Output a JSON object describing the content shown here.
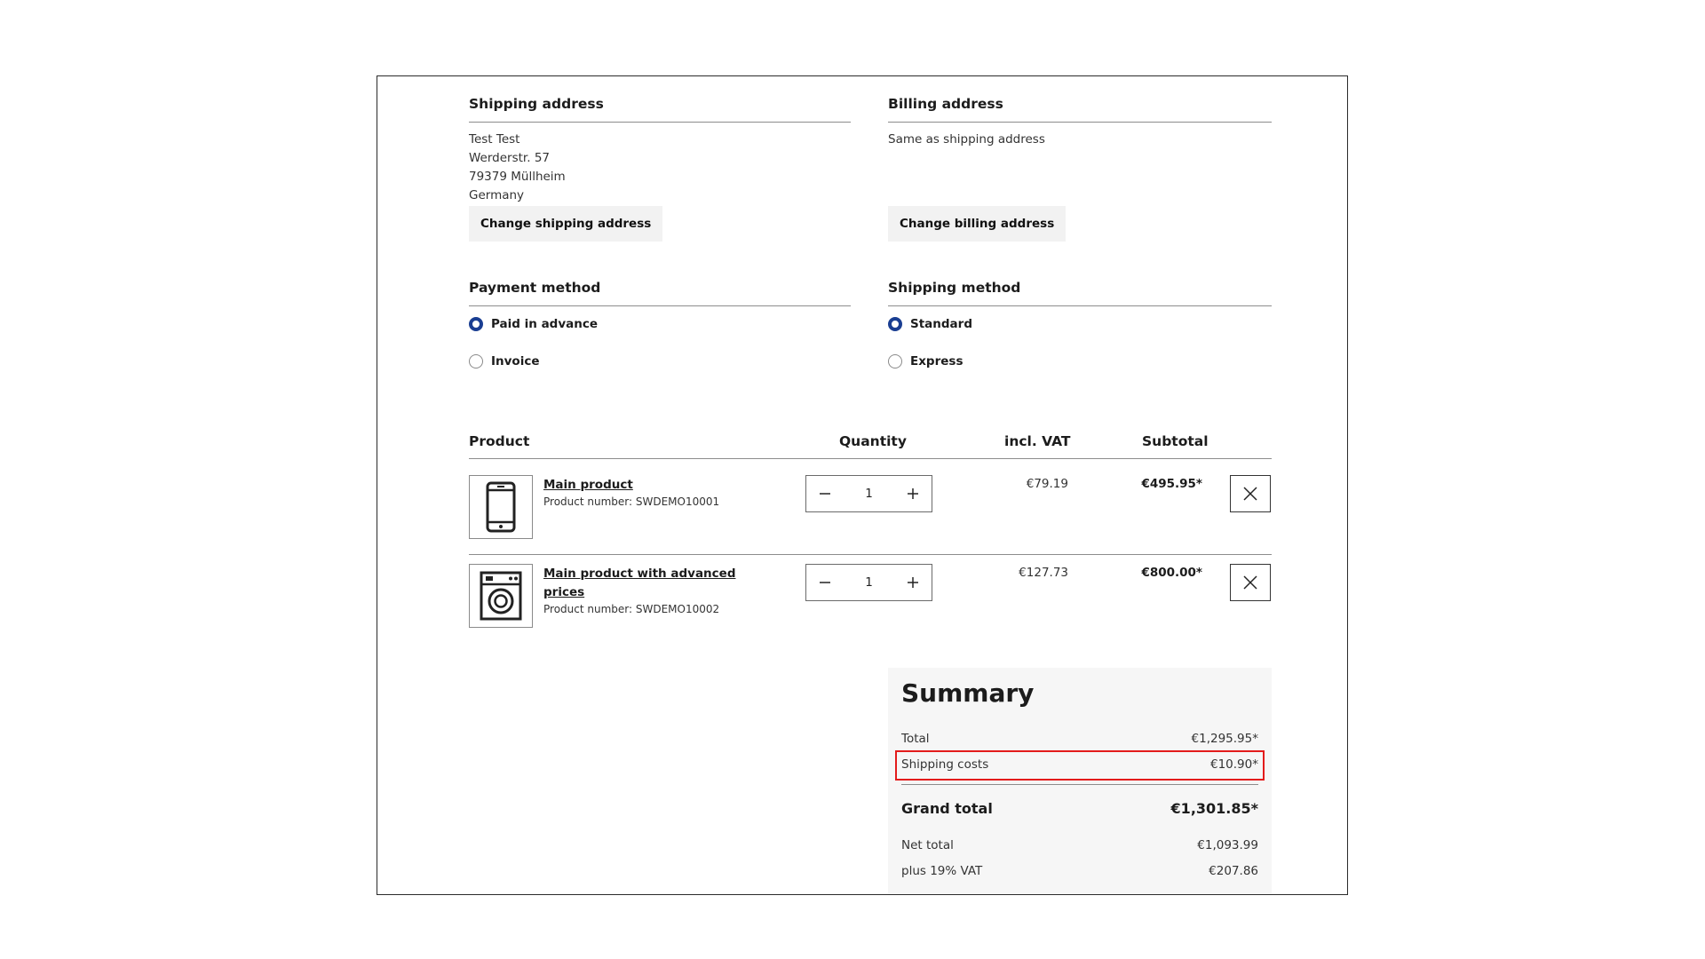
{
  "addresses": {
    "shipping": {
      "title": "Shipping address",
      "lines": [
        "Test Test",
        "Werderstr. 57",
        "79379 Müllheim",
        "Germany"
      ],
      "button": "Change shipping address"
    },
    "billing": {
      "title": "Billing address",
      "text": "Same as shipping address",
      "button": "Change billing address"
    }
  },
  "payment": {
    "title": "Payment method",
    "options": [
      {
        "label": "Paid in advance",
        "selected": true
      },
      {
        "label": "Invoice",
        "selected": false
      }
    ]
  },
  "shipping_method": {
    "title": "Shipping method",
    "options": [
      {
        "label": "Standard",
        "selected": true
      },
      {
        "label": "Express",
        "selected": false
      }
    ]
  },
  "cart": {
    "headers": {
      "product": "Product",
      "quantity": "Quantity",
      "incl_vat": "incl. VAT",
      "subtotal": "Subtotal"
    },
    "items": [
      {
        "name": "Main product",
        "number": "Product number: SWDEMO10001",
        "quantity": "1",
        "unit_price": "€79.19",
        "subtotal": "€495.95*",
        "icon": "smartphone-icon"
      },
      {
        "name_line1": "Main product with advanced",
        "name_line2": "prices",
        "number": "Product number: SWDEMO10002",
        "quantity": "1",
        "unit_price": "€127.73",
        "subtotal": "€800.00*",
        "icon": "washing-machine-icon"
      }
    ]
  },
  "summary": {
    "title": "Summary",
    "total_label": "Total",
    "total_value": "€1,295.95*",
    "shipping_label": "Shipping costs",
    "shipping_value": "€10.90*",
    "grand_total_label": "Grand total",
    "grand_total_value": "€1,301.85*",
    "net_label": "Net total",
    "net_value": "€1,093.99",
    "vat_label": "plus 19% VAT",
    "vat_value": "€207.86"
  },
  "colors": {
    "radio_selected": "#1a3e92",
    "highlight": "#e31b1b",
    "summary_bg": "#f6f6f6"
  }
}
